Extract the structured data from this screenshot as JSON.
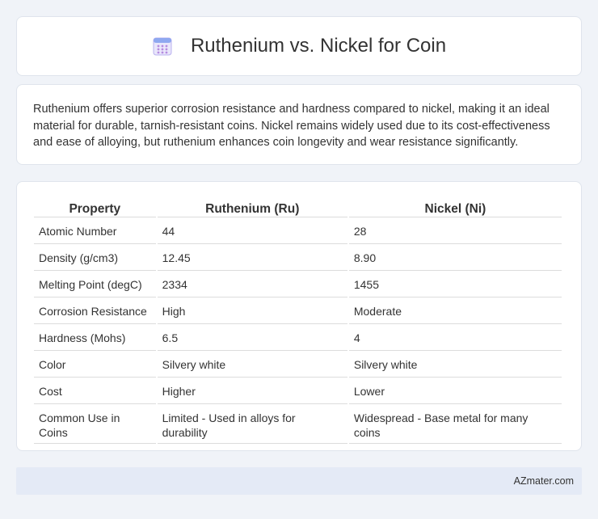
{
  "header": {
    "icon": "calendar-icon",
    "title": "Ruthenium vs. Nickel for Coin"
  },
  "description": "Ruthenium offers superior corrosion resistance and hardness compared to nickel, making it an ideal material for durable, tarnish-resistant coins. Nickel remains widely used due to its cost-effectiveness and ease of alloying, but ruthenium enhances coin longevity and wear resistance significantly.",
  "table": {
    "headers": [
      "Property",
      "Ruthenium (Ru)",
      "Nickel (Ni)"
    ],
    "rows": [
      [
        "Atomic Number",
        "44",
        "28"
      ],
      [
        "Density (g/cm3)",
        "12.45",
        "8.90"
      ],
      [
        "Melting Point (degC)",
        "2334",
        "1455"
      ],
      [
        "Corrosion Resistance",
        "High",
        "Moderate"
      ],
      [
        "Hardness (Mohs)",
        "6.5",
        "4"
      ],
      [
        "Color",
        "Silvery white",
        "Silvery white"
      ],
      [
        "Cost",
        "Higher",
        "Lower"
      ],
      [
        "Common Use in Coins",
        "Limited - Used in alloys for durability",
        "Widespread - Base metal for many coins"
      ]
    ]
  },
  "footer": {
    "source": "AZmater.com"
  },
  "colors": {
    "background": "#f0f3f8",
    "card": "#ffffff",
    "footer": "#e4eaf6",
    "icon_accent": "#8b7fd6"
  }
}
